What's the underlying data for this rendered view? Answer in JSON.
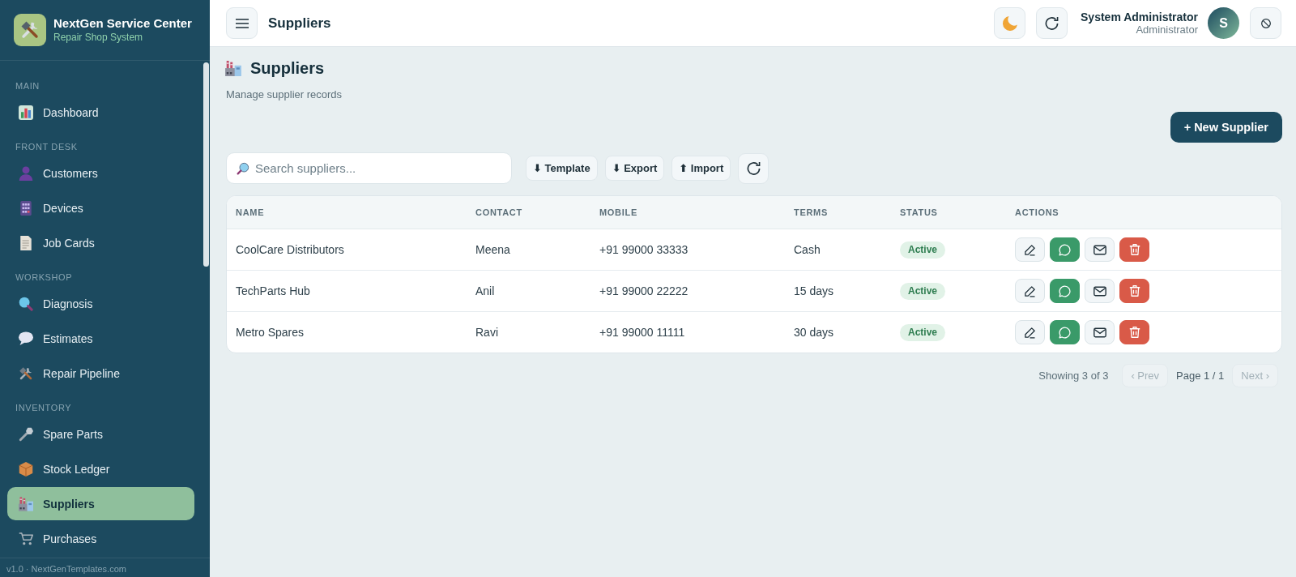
{
  "sidebar": {
    "brand": {
      "title": "NextGen Service Center",
      "subtitle": "Repair Shop System"
    },
    "sections": [
      {
        "label": "MAIN",
        "items": [
          {
            "label": "Dashboard",
            "selected": false
          }
        ]
      },
      {
        "label": "FRONT DESK",
        "items": [
          {
            "label": "Customers",
            "selected": false
          },
          {
            "label": "Devices",
            "selected": false
          },
          {
            "label": "Job Cards",
            "selected": false
          }
        ]
      },
      {
        "label": "WORKSHOP",
        "items": [
          {
            "label": "Diagnosis",
            "selected": false
          },
          {
            "label": "Estimates",
            "selected": false
          },
          {
            "label": "Repair Pipeline",
            "selected": false
          }
        ]
      },
      {
        "label": "INVENTORY",
        "items": [
          {
            "label": "Spare Parts",
            "selected": false
          },
          {
            "label": "Stock Ledger",
            "selected": false
          },
          {
            "label": "Suppliers",
            "selected": true
          },
          {
            "label": "Purchases",
            "selected": false
          }
        ]
      }
    ],
    "footer": "v1.0 · NextGenTemplates.com"
  },
  "header": {
    "title": "Suppliers",
    "user": {
      "name": "System Administrator",
      "role": "Administrator",
      "initial": "S"
    }
  },
  "page": {
    "title": "Suppliers",
    "subtitle": "Manage supplier records",
    "new_button": "+ New Supplier"
  },
  "toolbar": {
    "search": {
      "placeholder": "Search suppliers..."
    },
    "buttons": [
      "⬇ Template",
      "⬇ Export",
      "⬆ Import"
    ]
  },
  "table": {
    "columns": [
      "NAME",
      "CONTACT",
      "MOBILE",
      "TERMS",
      "STATUS",
      "ACTIONS"
    ],
    "rows": [
      {
        "name": "CoolCare Distributors",
        "contact": "Meena",
        "mobile": "+91 99000 33333",
        "terms": "Cash",
        "status": "Active"
      },
      {
        "name": "TechParts Hub",
        "contact": "Anil",
        "mobile": "+91 99000 22222",
        "terms": "15 days",
        "status": "Active"
      },
      {
        "name": "Metro Spares",
        "contact": "Ravi",
        "mobile": "+91 99000 11111",
        "terms": "30 days",
        "status": "Active"
      }
    ]
  },
  "pagination": {
    "summary": "Showing 3 of 3",
    "prev": {
      "label": "‹ Prev",
      "disabled": true
    },
    "page": "Page 1 / 1",
    "next": {
      "label": "Next ›",
      "disabled": true
    }
  }
}
